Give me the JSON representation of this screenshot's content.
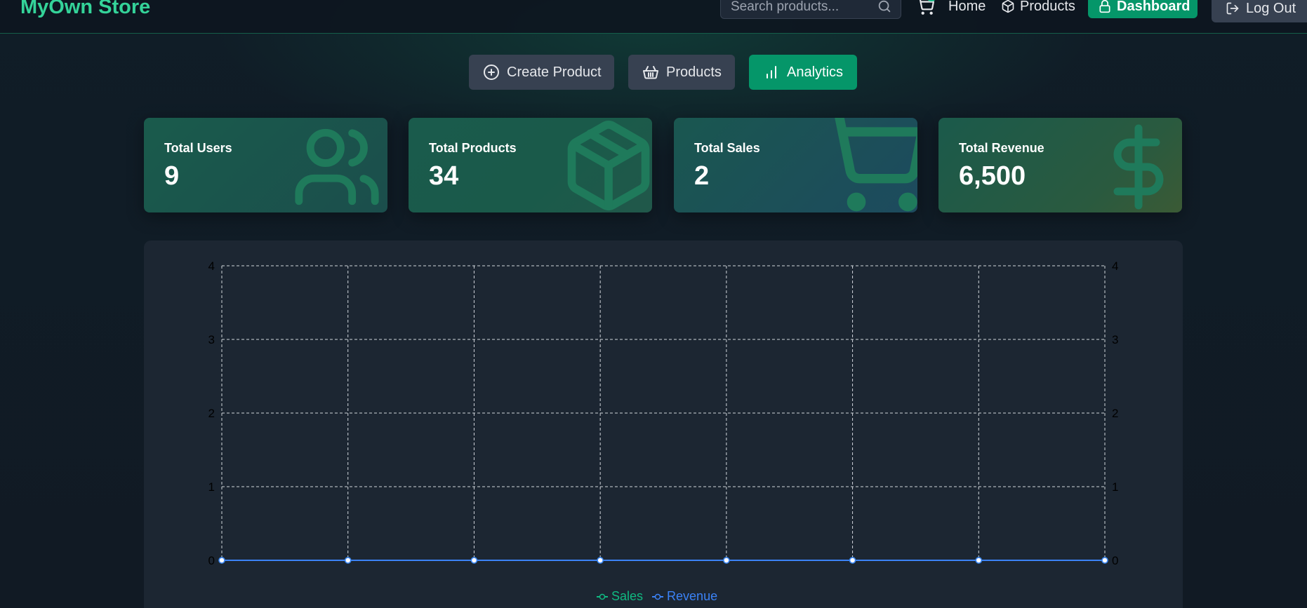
{
  "navbar": {
    "logo": "MyOwn Store",
    "search_placeholder": "Search products...",
    "home_label": "Home",
    "products_label": "Products",
    "dashboard_label": "Dashboard",
    "logout_label": "Log Out"
  },
  "tabs": [
    {
      "label": "Create Product",
      "icon": "plus-circle-icon",
      "active": false
    },
    {
      "label": "Products",
      "icon": "basket-icon",
      "active": false
    },
    {
      "label": "Analytics",
      "icon": "bar-chart-icon",
      "active": true
    }
  ],
  "stats": [
    {
      "label": "Total Users",
      "value": "9",
      "icon": "users-icon"
    },
    {
      "label": "Total Products",
      "value": "34",
      "icon": "package-icon"
    },
    {
      "label": "Total Sales",
      "value": "2",
      "icon": "shopping-cart-icon"
    },
    {
      "label": "Total Revenue",
      "value": "6,500",
      "icon": "dollar-sign-icon"
    }
  ],
  "colors": {
    "accent": "#10b981",
    "accent_button": "#059669",
    "sales": "#10b981",
    "revenue": "#3b82f6"
  },
  "chart_data": {
    "type": "line",
    "x": [
      "",
      "",
      "",
      "",
      "",
      "",
      "",
      ""
    ],
    "series": [
      {
        "name": "Sales",
        "values": [
          0,
          0,
          0,
          0,
          0,
          0,
          0,
          0
        ],
        "axis": "left"
      },
      {
        "name": "Revenue",
        "values": [
          0,
          0,
          0,
          0,
          0,
          0,
          0,
          0
        ],
        "axis": "right"
      }
    ],
    "y_ticks": [
      0,
      1,
      2,
      3,
      4
    ],
    "y2_ticks": [
      0,
      1,
      2,
      3,
      4
    ],
    "ylim": [
      0,
      4
    ],
    "y2lim": [
      0,
      4
    ],
    "grid": true,
    "legend_position": "bottom-center"
  }
}
